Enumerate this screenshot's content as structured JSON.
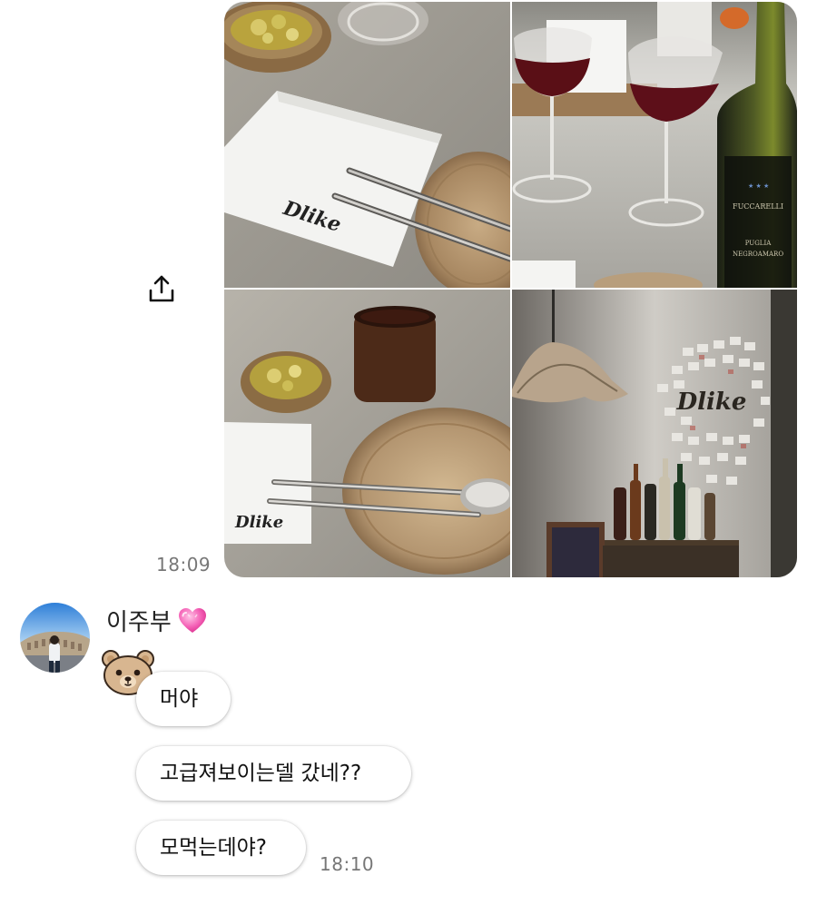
{
  "outgoing": {
    "time": "18:09",
    "share_icon": "share-upload-icon",
    "photos": [
      {
        "name": "photo-napkin-chopsticks",
        "logo": "Dlike"
      },
      {
        "name": "photo-wine-glasses-bottle",
        "logo": "",
        "bottle_label_1": "FUCCARELLI",
        "bottle_label_2": "PUGLIA",
        "bottle_label_3": "NEGROAMARO"
      },
      {
        "name": "photo-table-setting",
        "logo": "Dlike"
      },
      {
        "name": "photo-bar-wall",
        "logo": "Dlike"
      }
    ]
  },
  "incoming": {
    "sender_name": "이주부",
    "sender_emoji": "pink-heart-icon",
    "sticker": "bear-face-icon",
    "messages": [
      {
        "text": "머야"
      },
      {
        "text": "고급져보이는델 갔네??"
      },
      {
        "text": "모먹는데야?"
      }
    ],
    "time": "18:10"
  }
}
